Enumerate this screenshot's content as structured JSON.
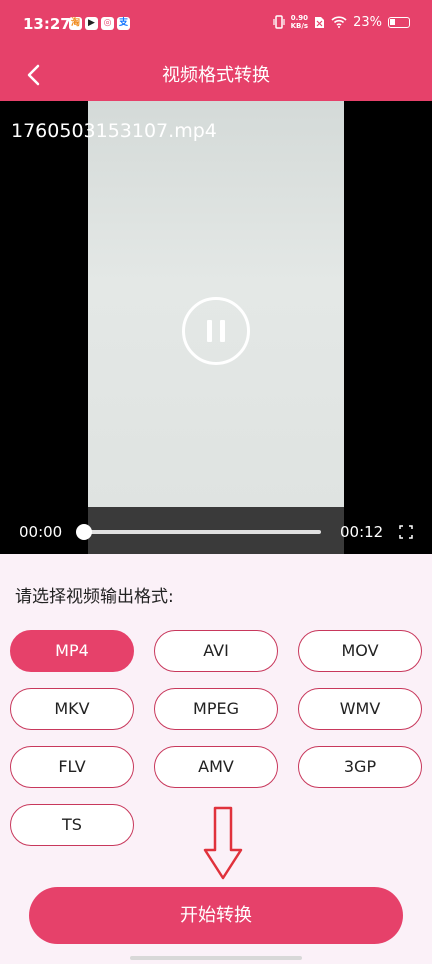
{
  "status_bar": {
    "time": "13:27",
    "app_icons": [
      "淘",
      "▶",
      "◎",
      "支"
    ],
    "net_speed_value": "0.90",
    "net_speed_unit": "KB/s",
    "battery": "23%"
  },
  "header": {
    "title": "视频格式转换"
  },
  "player": {
    "file_name": "1760503153107.mp4",
    "current_time": "00:00",
    "total_time": "00:12",
    "progress": 0.0
  },
  "format_section": {
    "prompt": "请选择视频输出格式:",
    "formats": [
      "MP4",
      "AVI",
      "MOV",
      "MKV",
      "MPEG",
      "WMV",
      "FLV",
      "AMV",
      "3GP",
      "TS"
    ],
    "selected": "MP4"
  },
  "start_button": {
    "label": "开始转换"
  },
  "colors": {
    "accent": "#e6416a",
    "background": "#fbf1f8",
    "arrow": "#e0323c"
  }
}
